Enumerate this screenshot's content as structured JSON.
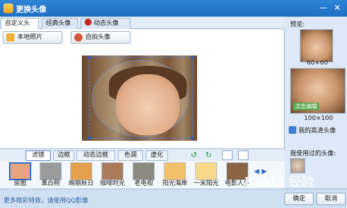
{
  "window": {
    "title": "更换头像",
    "minimize": "—",
    "close": "✕"
  },
  "tabs": [
    {
      "label": "自定义头像",
      "active": true
    },
    {
      "label": "经典头像",
      "active": false
    },
    {
      "label": "动态头像",
      "active": false
    }
  ],
  "toolbar": {
    "local_photo": "本地照片",
    "selfie": "自拍头像"
  },
  "filter_tabs": [
    {
      "label": "滤镜",
      "active": true
    },
    {
      "label": "边框",
      "active": false
    },
    {
      "label": "动态边框",
      "active": false
    },
    {
      "label": "色调",
      "active": false
    },
    {
      "label": "虚化",
      "active": false
    }
  ],
  "filters": [
    {
      "label": "原图",
      "color": "#e7a37f",
      "selected": true
    },
    {
      "label": "黑白照",
      "color": "#9b9b9b",
      "selected": false
    },
    {
      "label": "绚丽秋日",
      "color": "#e5a04d",
      "selected": false
    },
    {
      "label": "咖啡时光",
      "color": "#a97b5a",
      "selected": false
    },
    {
      "label": "老电视",
      "color": "#8c8a7f",
      "selected": false
    },
    {
      "label": "阳光海岸",
      "color": "#f3c06a",
      "selected": false
    },
    {
      "label": "一米阳光",
      "color": "#f7d78a",
      "selected": false
    },
    {
      "label": "电影人生",
      "color": "#8c6445",
      "selected": false
    }
  ],
  "right_panel": {
    "preview_label": "预览:",
    "size_small": "60×60",
    "size_large": "100×100",
    "hd_avatar": "我的高清头像",
    "used_label": "我使用过的头像:",
    "badge": "点击编辑"
  },
  "footer": {
    "more_effects": "更多精彩特效，请使用QQ影像",
    "ok": "确定",
    "cancel": "取消"
  },
  "watermark": "Baidu 经验"
}
